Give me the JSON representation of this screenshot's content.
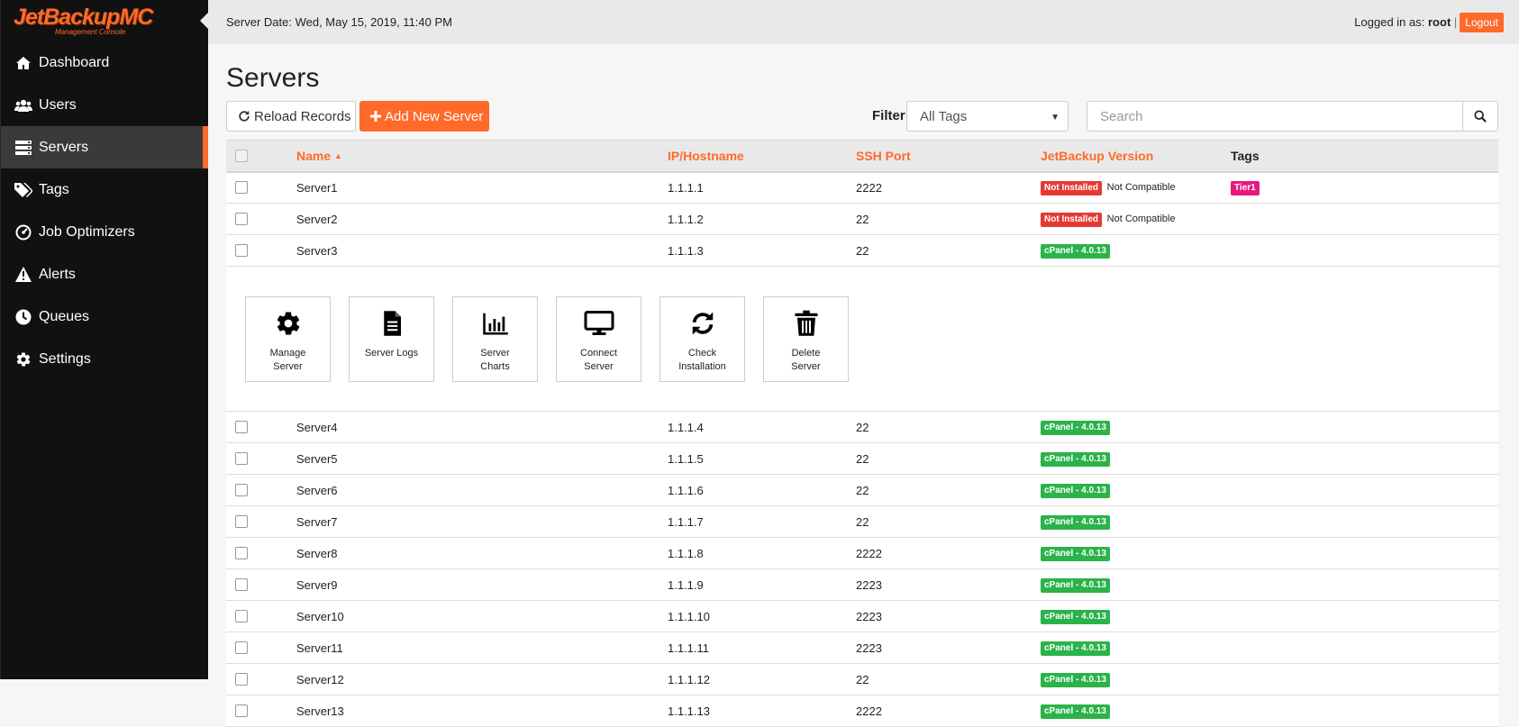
{
  "app": {
    "logo_text": "JetBackupMC",
    "logo_subtitle": "Management Console"
  },
  "sidebar": {
    "items": [
      {
        "label": "Dashboard",
        "icon": "home-icon"
      },
      {
        "label": "Users",
        "icon": "users-icon"
      },
      {
        "label": "Servers",
        "icon": "servers-icon",
        "active": true
      },
      {
        "label": "Tags",
        "icon": "tags-icon"
      },
      {
        "label": "Job Optimizers",
        "icon": "gauge-icon"
      },
      {
        "label": "Alerts",
        "icon": "warning-icon"
      },
      {
        "label": "Queues",
        "icon": "clock-icon"
      },
      {
        "label": "Settings",
        "icon": "gear-icon"
      }
    ]
  },
  "topbar": {
    "server_date": "Server Date: Wed, May 15, 2019, 11:40 PM",
    "logged_in_prefix": "Logged in as:",
    "username": "root",
    "separator": "|",
    "logout_label": "Logout"
  },
  "page": {
    "title": "Servers"
  },
  "toolbar": {
    "reload_label": "Reload Records",
    "add_label": "Add New Server",
    "filter_label": "Filter",
    "filter_value": "All Tags",
    "search_placeholder": "Search"
  },
  "table": {
    "headers": {
      "name": "Name",
      "ip": "IP/Hostname",
      "ssh": "SSH Port",
      "version": "JetBackup Version",
      "tags": "Tags"
    },
    "rows": [
      {
        "name": "Server1",
        "ip": "1.1.1.1",
        "ssh": "2222",
        "badge": "Not Installed",
        "badge_color": "#e53935",
        "note": "Not Compatible",
        "tag": "Tier1"
      },
      {
        "name": "Server2",
        "ip": "1.1.1.2",
        "ssh": "22",
        "badge": "Not Installed",
        "badge_color": "#e53935",
        "note": "Not Compatible",
        "tag": ""
      },
      {
        "name": "Server3",
        "ip": "1.1.1.3",
        "ssh": "22",
        "badge": "cPanel - 4.0.13",
        "badge_color": "#2bb34a",
        "note": "",
        "tag": ""
      },
      {
        "name": "Server4",
        "ip": "1.1.1.4",
        "ssh": "22",
        "badge": "cPanel - 4.0.13",
        "badge_color": "#2bb34a",
        "note": "",
        "tag": ""
      },
      {
        "name": "Server5",
        "ip": "1.1.1.5",
        "ssh": "22",
        "badge": "cPanel - 4.0.13",
        "badge_color": "#2bb34a",
        "note": "",
        "tag": ""
      },
      {
        "name": "Server6",
        "ip": "1.1.1.6",
        "ssh": "22",
        "badge": "cPanel - 4.0.13",
        "badge_color": "#2bb34a",
        "note": "",
        "tag": ""
      },
      {
        "name": "Server7",
        "ip": "1.1.1.7",
        "ssh": "22",
        "badge": "cPanel - 4.0.13",
        "badge_color": "#2bb34a",
        "note": "",
        "tag": ""
      },
      {
        "name": "Server8",
        "ip": "1.1.1.8",
        "ssh": "2222",
        "badge": "cPanel - 4.0.13",
        "badge_color": "#2bb34a",
        "note": "",
        "tag": ""
      },
      {
        "name": "Server9",
        "ip": "1.1.1.9",
        "ssh": "2223",
        "badge": "cPanel - 4.0.13",
        "badge_color": "#2bb34a",
        "note": "",
        "tag": ""
      },
      {
        "name": "Server10",
        "ip": "1.1.1.10",
        "ssh": "2223",
        "badge": "cPanel - 4.0.13",
        "badge_color": "#2bb34a",
        "note": "",
        "tag": ""
      },
      {
        "name": "Server11",
        "ip": "1.1.1.11",
        "ssh": "2223",
        "badge": "cPanel - 4.0.13",
        "badge_color": "#2bb34a",
        "note": "",
        "tag": ""
      },
      {
        "name": "Server12",
        "ip": "1.1.1.12",
        "ssh": "22",
        "badge": "cPanel - 4.0.13",
        "badge_color": "#2bb34a",
        "note": "",
        "tag": ""
      },
      {
        "name": "Server13",
        "ip": "1.1.1.13",
        "ssh": "2222",
        "badge": "cPanel - 4.0.13",
        "badge_color": "#2bb34a",
        "note": "",
        "tag": ""
      }
    ],
    "tag_color": "#e6197e",
    "expanded_after_row": 2,
    "row_actions": [
      {
        "label": "Manage Server",
        "icon": "gear-icon"
      },
      {
        "label": "Server Logs",
        "icon": "file-icon"
      },
      {
        "label": "Server Charts",
        "icon": "bar-chart-icon"
      },
      {
        "label": "Connect Server",
        "icon": "monitor-icon"
      },
      {
        "label": "Check Installation",
        "icon": "refresh-icon"
      },
      {
        "label": "Delete Server",
        "icon": "trash-icon"
      }
    ]
  },
  "colors": {
    "accent": "#ff6a2a",
    "sidebar_bg": "#111111",
    "topbar_bg": "#e9e9e9"
  }
}
